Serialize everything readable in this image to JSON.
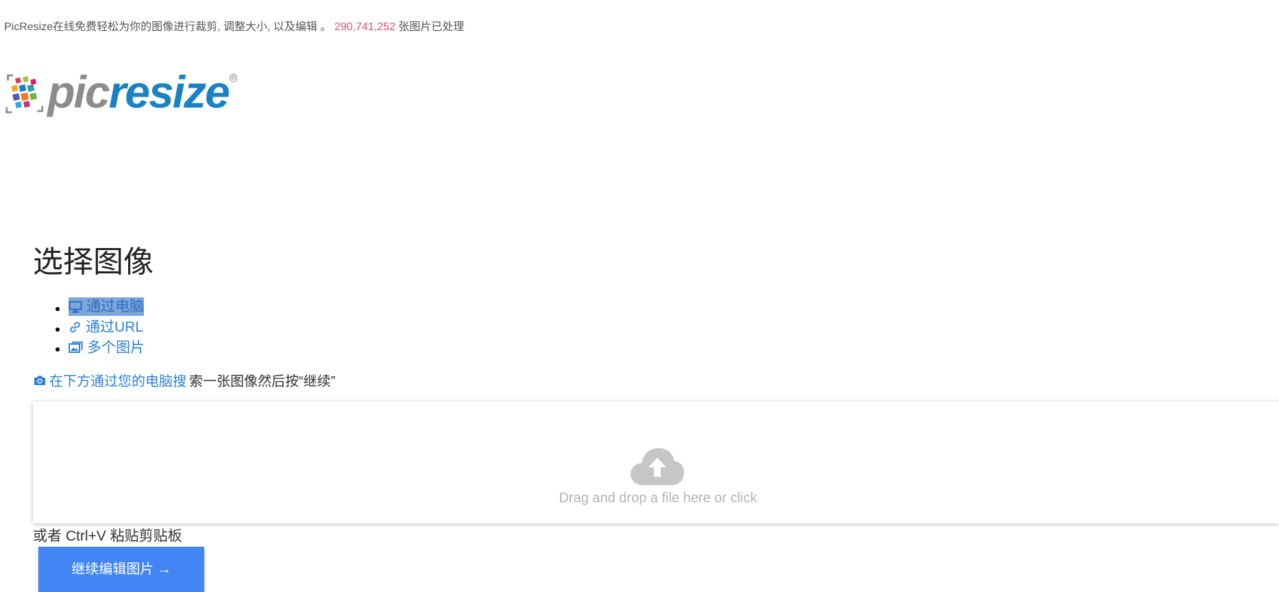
{
  "header": {
    "tagline_text": "PicResize在线免费轻松为你的图像进行裁剪, 调整大小, 以及编辑 。",
    "processed_count": "290,741,252",
    "processed_suffix": "张图片已处理"
  },
  "logo": {
    "pic": "pic",
    "resize": "resize",
    "registered": "®",
    "colors": {
      "pic": "#8c8c8c",
      "resize": "#1a82c4"
    }
  },
  "main": {
    "title": "选择图像",
    "options": [
      {
        "label": "通过电脑",
        "icon": "desktop-icon",
        "active": true
      },
      {
        "label": "通过URL",
        "icon": "link-icon",
        "active": false
      },
      {
        "label": "多个图片",
        "icon": "images-icon",
        "active": false
      }
    ],
    "hint_link": "在下方通过您的电脑搜",
    "hint_rest": "索一张图像然后按“继续”",
    "dropzone": {
      "icon": "cloud-upload-icon",
      "text": "Drag and drop a file here or click"
    },
    "paste_hint": "或者 Ctrl+V 粘贴剪贴板",
    "continue_button": "继续编辑图片 →"
  },
  "colors": {
    "accent": "#4285f4",
    "link": "#2b7fd8",
    "count": "#e0506e"
  }
}
